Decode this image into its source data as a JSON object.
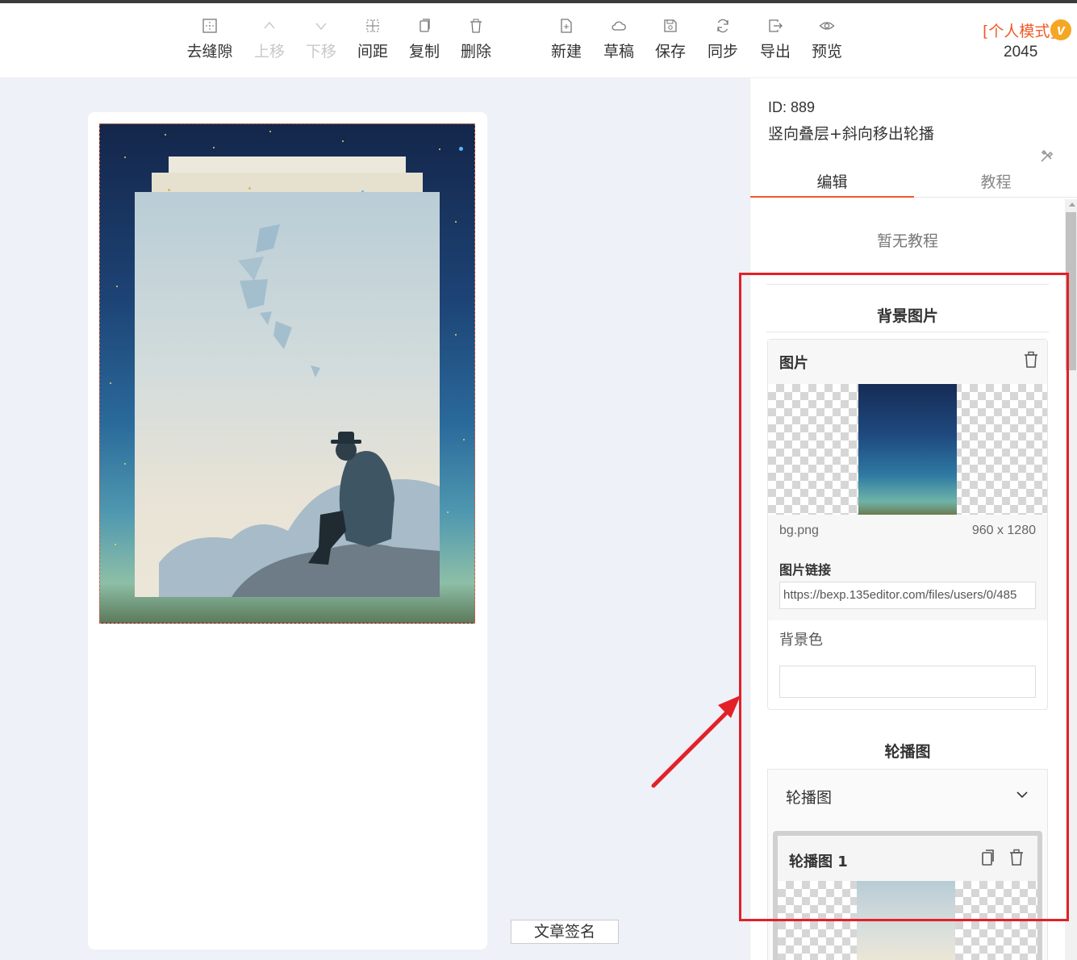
{
  "toolbar": {
    "items": [
      {
        "label": "去缝隙",
        "icon": "gap-icon",
        "disabled": false
      },
      {
        "label": "上移",
        "icon": "chevron-up-icon",
        "disabled": true
      },
      {
        "label": "下移",
        "icon": "chevron-down-icon",
        "disabled": true
      },
      {
        "label": "间距",
        "icon": "spacing-icon",
        "disabled": false
      },
      {
        "label": "复制",
        "icon": "copy-icon",
        "disabled": false
      },
      {
        "label": "删除",
        "icon": "trash-icon",
        "disabled": false
      },
      {
        "label": "新建",
        "icon": "new-file-icon",
        "disabled": false
      },
      {
        "label": "草稿",
        "icon": "cloud-icon",
        "disabled": false
      },
      {
        "label": "保存",
        "icon": "save-icon",
        "disabled": false
      },
      {
        "label": "同步",
        "icon": "sync-icon",
        "disabled": false
      },
      {
        "label": "导出",
        "icon": "export-icon",
        "disabled": false
      },
      {
        "label": "预览",
        "icon": "eye-icon",
        "disabled": false
      }
    ],
    "mode_label": "[个人模式]",
    "vip_badge": "v",
    "count": "2045"
  },
  "canvas": {
    "signature_button": "文章签名"
  },
  "panel": {
    "id_text": "ID: 889",
    "template_title": "竖向叠层+斜向移出轮播",
    "tabs": [
      {
        "label": "编辑",
        "active": true
      },
      {
        "label": "教程",
        "active": false
      }
    ],
    "no_tutorial": "暂无教程",
    "background_section": {
      "heading": "背景图片",
      "image_label": "图片",
      "file_name": "bg.png",
      "file_size": "960 x 1280",
      "link_label": "图片链接",
      "link_value": "https://bexp.135editor.com/files/users/0/485",
      "bgcolor_label": "背景色",
      "bgcolor_value": ""
    },
    "carousel_section": {
      "heading": "轮播图",
      "group_label": "轮播图",
      "slide_title": "轮播图 1"
    }
  },
  "colors": {
    "accent": "#f05a28",
    "annotation": "#e32027",
    "vip": "#f5a623",
    "canvas_bg": "#eef1f7"
  }
}
